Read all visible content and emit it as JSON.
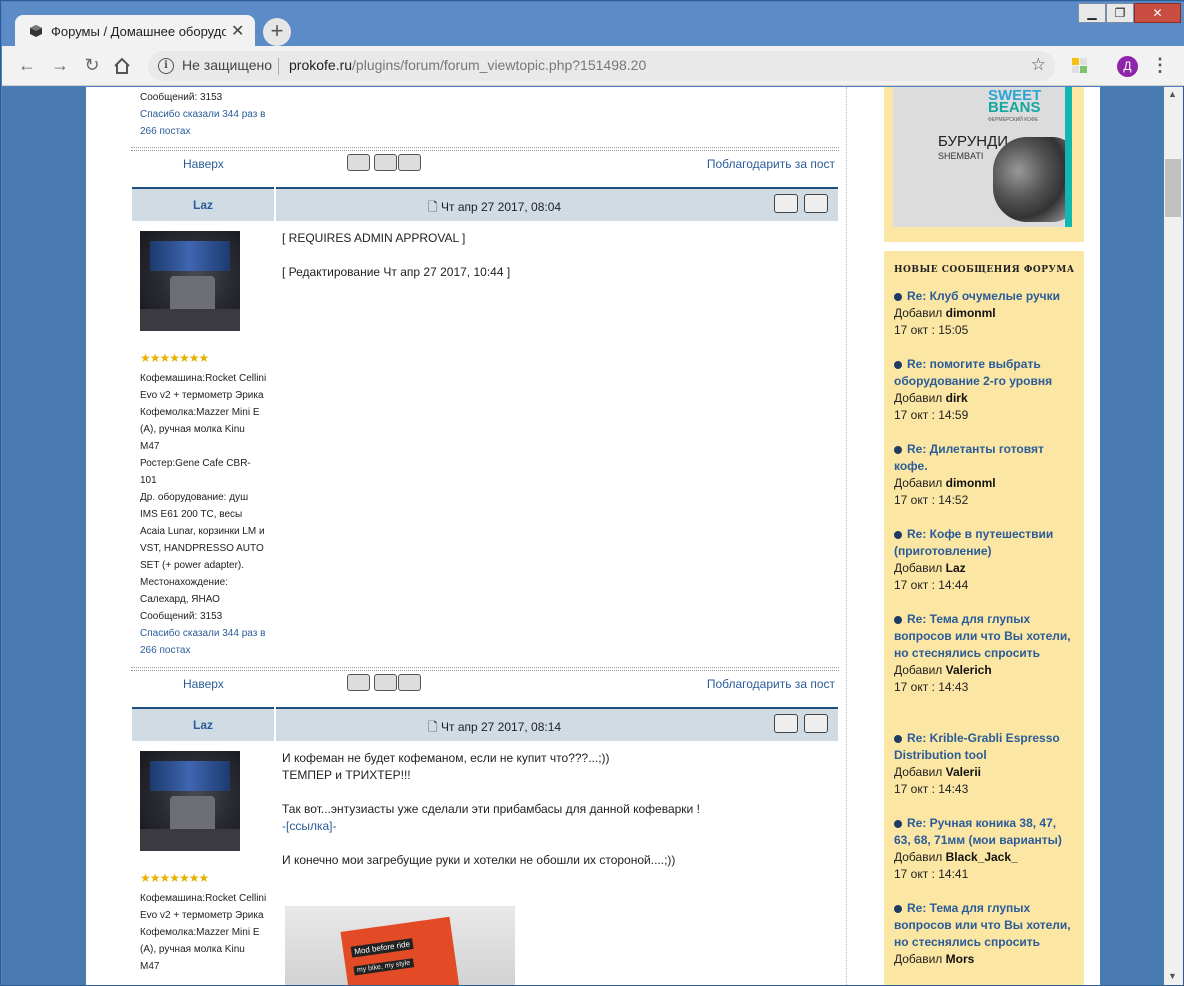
{
  "browser": {
    "tab_title": "Форумы / Домашнее оборудов",
    "new_tab": "+",
    "security": "Не защищено",
    "url_domain": "prokofe.ru",
    "url_path": "/plugins/forum/forum_viewtopic.php?151498.20",
    "profile_initial": "Д"
  },
  "top_fragment": {
    "messages": "Сообщений: 3153",
    "thanks1": "Спасибо сказали 344 раз в",
    "thanks2": "266 постах"
  },
  "nav": {
    "top_link": "Наверх",
    "thank_link": "Поблагодарить за пост"
  },
  "posts": [
    {
      "author": "Laz",
      "date": "Чт апр 27 2017, 08:04",
      "stars": "★★★★★★★",
      "info": [
        "Кофемашина:Rocket Cellini",
        "Evo v2 + термометр Эрика",
        "Кофемолка:Mazzer Mini E",
        "(A), ручная молка Kinu",
        "M47",
        "Ростер:Gene Cafe CBR-",
        "101",
        "Др. оборудование: душ",
        "IMS E61 200 TC, весы",
        "Acaia Lunar, корзинки LM и",
        "VST, HANDPRESSO AUTO",
        "SET (+ power adapter).",
        "Местонахождение:",
        "Салехард, ЯНАО",
        "Сообщений: 3153"
      ],
      "thanks1": "Спасибо сказали 344 раз в",
      "thanks2": "266 постах",
      "text1": "[ REQUIRES ADMIN APPROVAL ]",
      "text2": "[ Редактирование Чт апр 27 2017, 10:44 ]"
    },
    {
      "author": "Laz",
      "date": "Чт апр 27 2017, 08:14",
      "stars": "★★★★★★★",
      "info": [
        "Кофемашина:Rocket Cellini",
        "Evo v2 + термометр Эрика",
        "Кофемолка:Mazzer Mini E",
        "(A), ручная молка Kinu",
        "M47"
      ],
      "line1": "И кофеман не будет кофеманом, если не купит что???...;))",
      "line2": "ТЕМПЕР и ТРИХТЕР!!!",
      "line3": "Так вот...энтузиасты уже сделали эти прибамбасы для данной кофеварки !",
      "link": "-[ссылка]-",
      "line4": "И конечно мои загребущие руки и хотелки не обошли их стороной....;))",
      "photo_label1": "Mod before ride",
      "photo_label2": "my bike, my style"
    }
  ],
  "ad": {
    "sweet": "SWEET",
    "beans": "BEANS",
    "farm": "ФЕРМЕРСКИЙ КОФЕ",
    "product": "БУРУНДИ",
    "sub": "SHEMBATI"
  },
  "news": {
    "header": "НОВЫЕ СООБЩЕНИЯ ФОРУМА",
    "added": "Добавил",
    "items": [
      {
        "title": "Re: Клуб очумелые ручки",
        "user": "dimonml",
        "time": "17 окт : 15:05"
      },
      {
        "title": "Re: помогите выбрать оборудование 2-го уровня",
        "user": "dirk",
        "time": "17 окт : 14:59"
      },
      {
        "title": "Re: Дилетанты готовят кофе.",
        "user": "dimonml",
        "time": "17 окт : 14:52"
      },
      {
        "title": "Re: Кофе в путешествии (приготовление)",
        "user": "Laz",
        "time": "17 окт : 14:44"
      },
      {
        "title": "Re: Тема для глупых вопросов или что Вы хотели, но стеснялись спросить",
        "user": "Valerich",
        "time": "17 окт : 14:43"
      },
      {
        "title": "Re: Krible-Grabli Espresso Distribution tool",
        "user": "Valerii",
        "time": "17 окт : 14:43"
      },
      {
        "title": "Re: Ручная коника 38, 47, 63, 68, 71мм (мои варианты)",
        "user": "Black_Jack_",
        "time": "17 окт : 14:41"
      },
      {
        "title": "Re: Тема для глупых вопросов или что Вы хотели, но стеснялись спросить",
        "user": "Mors",
        "time": ""
      }
    ]
  }
}
